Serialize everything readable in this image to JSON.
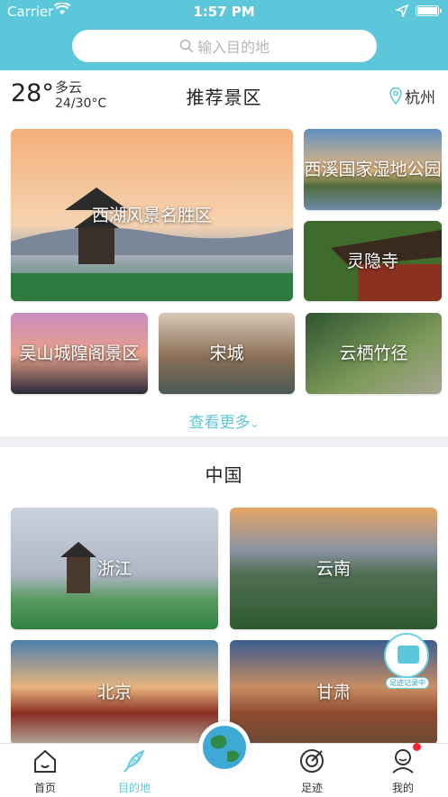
{
  "status_bar": {
    "carrier": "Carrier",
    "time": "1:57 PM"
  },
  "search": {
    "placeholder": "输入目的地"
  },
  "weather": {
    "temperature": "28°",
    "condition": "多云",
    "range": "24/30°C"
  },
  "recommend": {
    "title": "推荐景区",
    "city": "杭州",
    "spots": [
      {
        "name": "西湖风景名胜区"
      },
      {
        "name": "西溪国家湿地公园"
      },
      {
        "name": "灵隐寺"
      },
      {
        "name": "吴山城隍阁景区"
      },
      {
        "name": "宋城"
      },
      {
        "name": "云栖竹径"
      }
    ],
    "more_label": "查看更多"
  },
  "china": {
    "title": "中国",
    "provinces": [
      {
        "name": "浙江"
      },
      {
        "name": "云南"
      },
      {
        "name": "北京"
      },
      {
        "name": "甘肃"
      }
    ]
  },
  "floating": {
    "video_caption": "足迹记录中"
  },
  "tabbar": {
    "items": [
      {
        "label": "首页",
        "icon": "home-icon"
      },
      {
        "label": "目的地",
        "icon": "rocket-icon",
        "active": true
      },
      {
        "label": "",
        "icon": "globe-icon"
      },
      {
        "label": "足迹",
        "icon": "footprint-target-icon"
      },
      {
        "label": "我的",
        "icon": "user-icon"
      }
    ]
  },
  "colors": {
    "accent": "#5cc7da",
    "badge": "#ff2233"
  }
}
